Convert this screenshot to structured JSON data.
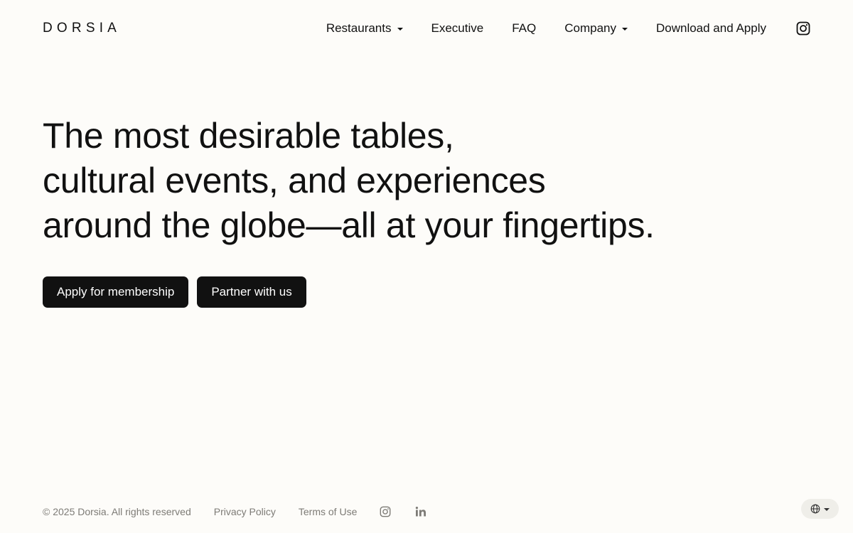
{
  "brand": {
    "logo": "DORSIA"
  },
  "nav": {
    "items": [
      {
        "label": "Restaurants",
        "has_dropdown": true
      },
      {
        "label": "Executive",
        "has_dropdown": false
      },
      {
        "label": "FAQ",
        "has_dropdown": false
      },
      {
        "label": "Company",
        "has_dropdown": true
      },
      {
        "label": "Download and Apply",
        "has_dropdown": false
      }
    ],
    "social_icon": "instagram-icon"
  },
  "hero": {
    "lines": [
      "The most desirable tables,",
      "cultural events, and experiences",
      "around the globe—all at your fingertips."
    ],
    "buttons": {
      "apply": "Apply for membership",
      "partner": "Partner with us"
    }
  },
  "footer": {
    "copyright": "© 2025 Dorsia. All rights reserved",
    "privacy": "Privacy Policy",
    "terms": "Terms of Use",
    "icons": [
      "instagram-icon",
      "linkedin-icon"
    ]
  },
  "language_selector": {
    "icon": "globe-icon"
  },
  "colors": {
    "background": "#fdfcf9",
    "text": "#111111",
    "button_bg": "#111111",
    "button_text": "#ffffff",
    "footer_text": "#7d7b76"
  }
}
